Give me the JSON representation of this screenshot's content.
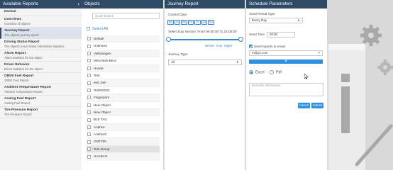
{
  "available_reports": {
    "title": "Available Reports",
    "section_label": "Normal",
    "items": [
      {
        "title": "Overviews",
        "desc": "Overview of objects"
      },
      {
        "title": "Journey Report",
        "desc": "The objects journey report"
      },
      {
        "title": "Driving Status Report",
        "desc": "The objects travel status information statistics"
      },
      {
        "title": "Alarm Report",
        "desc": "Alarm statistics for the object"
      },
      {
        "title": "Driver Behavior",
        "desc": "Driver statistics for the object"
      },
      {
        "title": "OBDII Fuel Report",
        "desc": "OBDII Fuel Report"
      },
      {
        "title": "Ambient Temperature Report",
        "desc": "Ambient Temperature Report"
      },
      {
        "title": "Analog Fuel Report",
        "desc": "Analog Fuel Report"
      },
      {
        "title": "Tire Pressure Report",
        "desc": "Tire Pressure Report"
      }
    ]
  },
  "objects": {
    "title": "Objects",
    "search_placeholder": "Quick Search",
    "select_all": "Select All",
    "items": [
      "Default",
      "Unknown",
      "Volkswagen",
      "Mercedes-Benz",
      "Honda",
      "Test",
      "test_ben",
      "TestRS232",
      "Fingerprint",
      "New Object",
      "New Object",
      "BLE TAG",
      "Andrew",
      "Andrew2",
      "GMT200",
      "Test Group",
      "HUABAO"
    ]
  },
  "journey": {
    "title": "Journey Report",
    "control_days_label": "Control Days",
    "days": [
      "Mo",
      "Tu",
      "We",
      "Th",
      "Fr",
      "Sa",
      "Su"
    ],
    "section_label": "Select Day Section: From 00:00:00 To 24:00:00",
    "range_presets": [
      "Whole",
      "Day",
      "Night"
    ],
    "journey_type_label": "Journey Type",
    "journey_type_value": "All"
  },
  "schedule": {
    "title": "Schedule Parameters",
    "send_period_label": "Send Period Type",
    "send_period_value": "Every Day",
    "send_time_label": "Send Time",
    "send_time_value": "00:00",
    "send_email_label": "Send reports to email",
    "email_value": "m@yo.com",
    "add_label": "+",
    "format_excel": "Excel",
    "format_pdf": "Pdf",
    "remarks_placeholder": "Remarks information",
    "cancel_label": "Cancel",
    "submit_label": "Submit"
  },
  "colors": {
    "header": "#2f4a64",
    "accent": "#2d8fe0",
    "link": "#3a87c9"
  }
}
